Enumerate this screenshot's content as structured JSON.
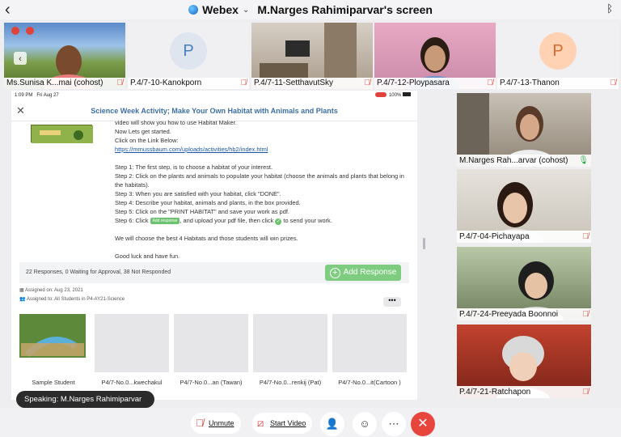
{
  "topbar": {
    "app_name": "Webex",
    "title": "M.Narges Rahimiparvar's screen"
  },
  "participants_top": [
    {
      "name": "Ms.Sunisa K...mai (cohost)",
      "muted": true
    },
    {
      "name": "P.4/7-10-Kanokporn",
      "muted": true,
      "initial": "P"
    },
    {
      "name": "P.4/7-11-SetthavutSky",
      "muted": true
    },
    {
      "name": "P.4/7-12-Ploypasara",
      "muted": true
    },
    {
      "name": "P.4/7-13-Thanon",
      "muted": true,
      "initial": "P"
    }
  ],
  "participants_side": [
    {
      "name": "M.Narges Rah...arvar (cohost)",
      "muted": false
    },
    {
      "name": "P.4/7-04-Pichayapa",
      "muted": true
    },
    {
      "name": "P.4/7-24-Preeyada Boonnoi",
      "muted": true
    },
    {
      "name": "P.4/7-21-Ratchapon",
      "muted": true
    }
  ],
  "shared": {
    "status_time": "1:09 PM",
    "status_date": "Fri Aug 27",
    "status_battery": "100%",
    "header_title": "Science Week Activity; Make Your Own Habitat with Animals and Plants",
    "instructions": {
      "line1": "video will show you how to use Habitat Maker.",
      "line2": "Now Lets get started.",
      "line3": "Click on the Link Below:",
      "link": "https://mrnussbaum.com/uploads/activities/hb2/index.html",
      "step1": "Step 1: The first step, is to choose a habitat of your interest.",
      "step2": "Step 2: Click on the plants and animals to populate your habitat (choose the animals and plants that belong in the habitats).",
      "step3": "Step 3: When you are satisfied with your habitat, click \"DONE\".",
      "step4": "Step 4: Describe your habitat, animals and plants, in the box provided.",
      "step5": "Step 5: Click on the \"PRINT HABITAT\" and save your work as pdf.",
      "step6_a": "Step 6: Click",
      "step6_badge": "Add response",
      "step6_b": ", and upload your pdf file, then click",
      "step6_c": "to send your work.",
      "prize": "We will choose the best 4 Habitats and those students will win prizes.",
      "closing": "Good luck and have fun."
    },
    "responses_summary": "22 Responses, 0 Waiting for Approval, 38 Not Responded",
    "add_response_label": "Add Response",
    "assigned_on": "Assigned on: Aug 23, 2021",
    "assigned_to": "Assigned to: All Students in P4-AY21-Science",
    "more_label": "•••",
    "submissions": [
      "Sample Student",
      "P4/7-No.0...kwechakul",
      "P4/7-No.0...an (Tawan)",
      "P4/7-No.0...renkij (Pat)",
      "P4/7-No.0...it(Cartoon )"
    ]
  },
  "speaking": "Speaking: M.Narges Rahimiparvar",
  "controls": {
    "unmute": "Unmute",
    "start_video": "Start Video"
  }
}
